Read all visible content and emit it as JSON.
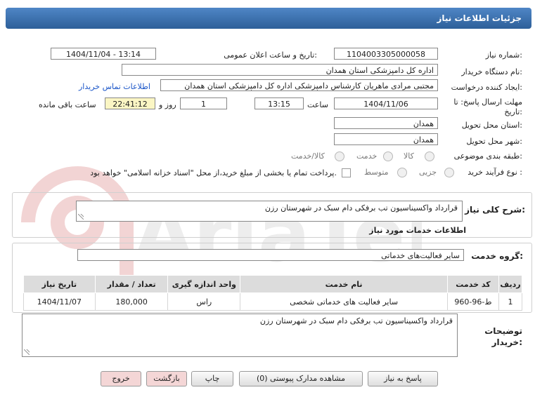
{
  "header": {
    "title": "جزئیات اطلاعات نیاز"
  },
  "form": {
    "need_number_label": "شماره نیاز:",
    "need_number": "1104003305000058",
    "announce_label": "تاریخ و ساعت اعلان عمومی:",
    "announce_value": "1404/11/04 - 13:14",
    "buyer_org_label": "نام دستگاه خریدار:",
    "buyer_org": "اداره کل دامپزشکی استان همدان",
    "requester_label": "ایجاد کننده درخواست:",
    "requester": "مجتبی مرادی ماهریان کارشناس دامپزشکی اداره کل دامپزشکی استان همدان",
    "contact_link": "اطلاعات تماس خریدار",
    "deadline_label_1": "مهلت ارسال پاسخ: تا",
    "deadline_label_2": "تاریخ:",
    "deadline_date": "1404/11/06",
    "time_label": "ساعت",
    "deadline_time": "13:15",
    "days_value": "1",
    "days_label": "روز و",
    "remaining_time": "22:41:12",
    "remaining_label": "ساعت باقی مانده",
    "province_label": "استان محل تحویل:",
    "province": "همدان",
    "city_label": "شهر محل تحویل:",
    "city": "همدان",
    "category_label": "طبقه بندی موضوعی:",
    "category_options": [
      "کالا",
      "خدمت",
      "کالا/خدمت"
    ],
    "purchase_type_label": "نوع فرآیند خرید :",
    "purchase_options": [
      "جزیی",
      "متوسط"
    ],
    "payment_note": "پرداخت تمام یا بخشی از مبلغ خرید،از محل \"اسناد خزانه اسلامی\" خواهد بود."
  },
  "summary": {
    "label": "شرح کلی نیاز:",
    "text": "قرارداد واکسیناسیون تب برفکی دام سبک در شهرستان رزن"
  },
  "services": {
    "section_title": "اطلاعات خدمات مورد نیاز",
    "group_label": "گروه خدمت:",
    "group_value": "سایر فعالیت‌های خدماتی",
    "columns": [
      "ردیف",
      "کد خدمت",
      "نام خدمت",
      "واحد اندازه گیری",
      "تعداد / مقدار",
      "تاریخ نیاز"
    ],
    "rows": [
      {
        "index": "1",
        "code": "ط-96-960",
        "name": "سایر فعالیت های خدماتی شخصی",
        "unit": "راس",
        "qty": "180,000",
        "date": "1404/11/07"
      }
    ]
  },
  "buyer_notes": {
    "label_1": "توضیحات",
    "label_2": "خریدار:",
    "text": "قرارداد واکسیناسیون تب برفکی دام سبک در شهرستان رزن"
  },
  "buttons": {
    "reply": "پاسخ به نیاز",
    "attachments": "مشاهده مدارک پیوستی (0)",
    "print": "چاپ",
    "back": "بازگشت",
    "exit": "خروج"
  }
}
